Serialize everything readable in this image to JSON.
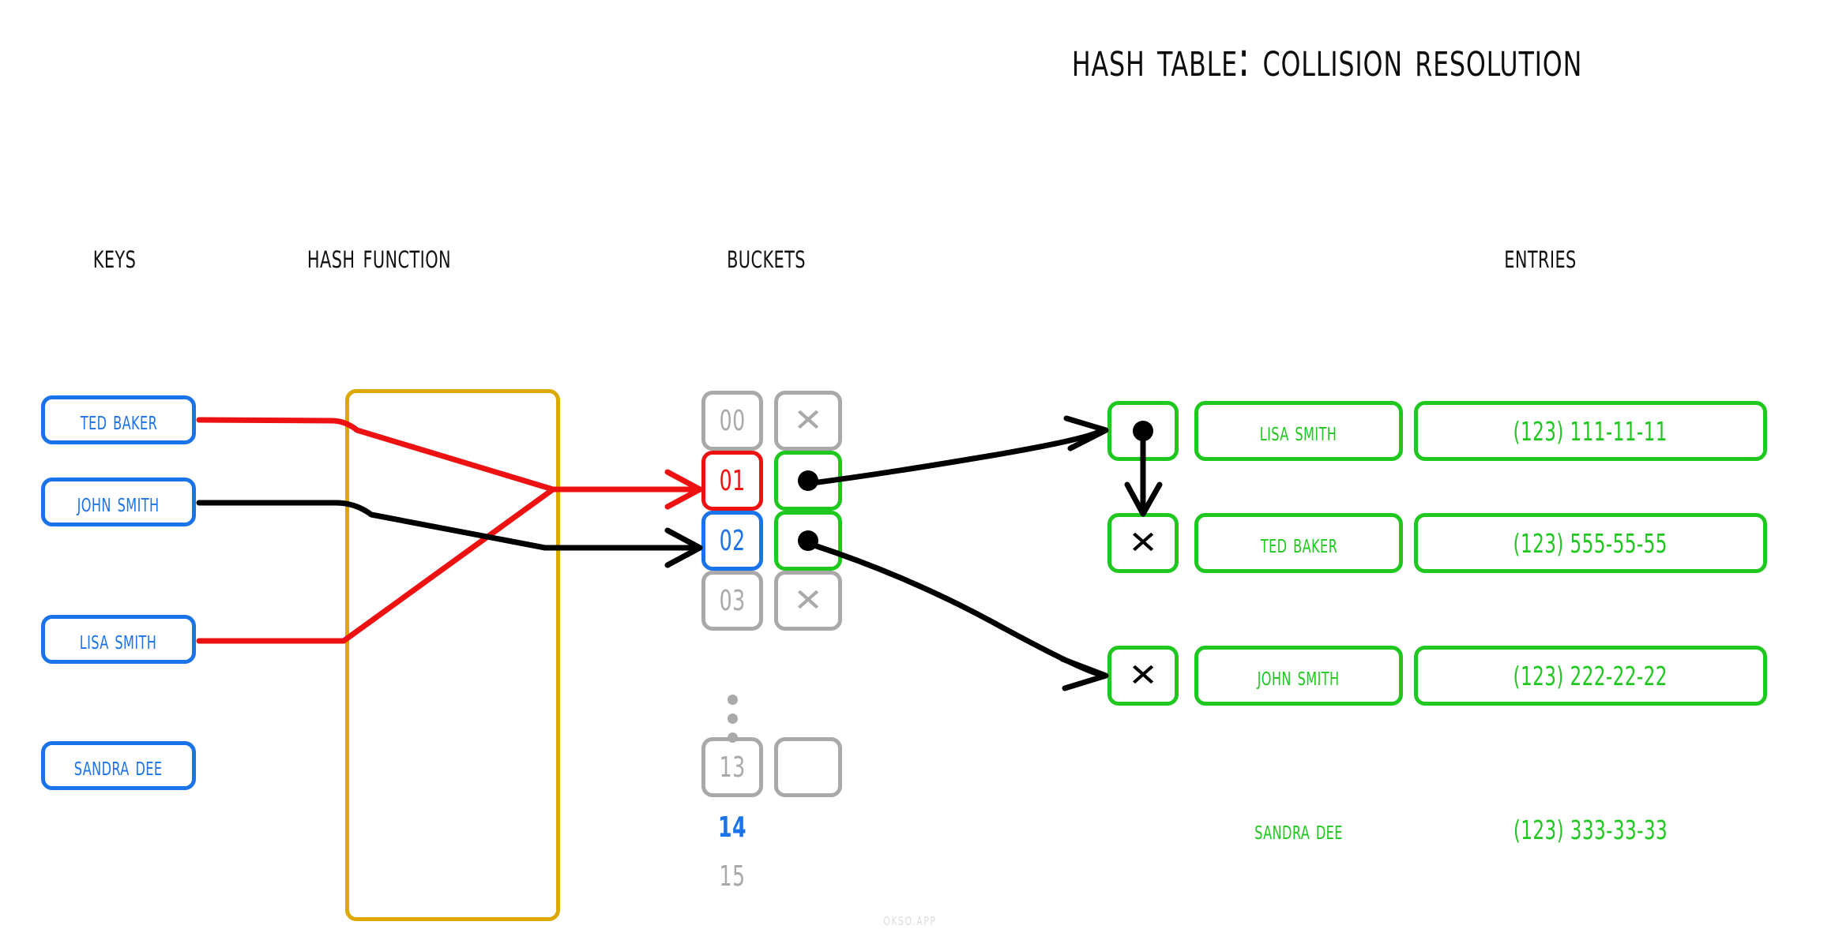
{
  "title": "Hash Table: Collision Resolution",
  "watermark": "OKSO.APP",
  "headers": {
    "keys": "Keys",
    "hash_function": "Hash Function",
    "buckets": "Buckets",
    "entries": "Entries"
  },
  "colors": {
    "key_blue": "#1a73e8",
    "entry_green": "#1ec81e",
    "bucket_gray": "#a9a9a9",
    "collision_red": "#ee1111",
    "hash_box_gold": "#dda800",
    "wire_black": "#000000"
  },
  "keys": [
    {
      "label": "Ted Baker",
      "wire_color": "#ee1111",
      "target_bucket": "01"
    },
    {
      "label": "John Smith",
      "wire_color": "#000000",
      "target_bucket": "02"
    },
    {
      "label": "Lisa Smith",
      "wire_color": "#ee1111",
      "target_bucket": "01"
    },
    {
      "label": "Sandra Dee",
      "wire_color": "none",
      "target_bucket": ""
    }
  ],
  "buckets": [
    {
      "index": "00",
      "state": "empty",
      "value_icon": "x-mark",
      "index_color": "#a9a9a9",
      "box_color": "#a9a9a9",
      "boxed": true
    },
    {
      "index": "01",
      "state": "filled",
      "value_icon": "dot",
      "index_color": "#ee1111",
      "box_color": "#1ec81e",
      "boxed": true
    },
    {
      "index": "02",
      "state": "filled",
      "value_icon": "dot",
      "index_color": "#1a73e8",
      "box_color": "#1ec81e",
      "boxed": true
    },
    {
      "index": "03",
      "state": "empty",
      "value_icon": "x-mark",
      "index_color": "#a9a9a9",
      "box_color": "#a9a9a9",
      "boxed": true
    },
    {
      "index": "13",
      "state": "blank",
      "value_icon": "none",
      "index_color": "#a9a9a9",
      "box_color": "#a9a9a9",
      "boxed": true
    },
    {
      "index": "14",
      "state": "label",
      "value_icon": "none",
      "index_color": "#1a73e8",
      "box_color": "none",
      "boxed": false
    },
    {
      "index": "15",
      "state": "label",
      "value_icon": "none",
      "index_color": "#a9a9a9",
      "box_color": "none",
      "boxed": false
    }
  ],
  "ellipsis": "vertical-dots",
  "entries": [
    {
      "pointer": "dot",
      "name": "Lisa Smith",
      "phone": "(123) 111-11-11",
      "boxed": true,
      "from_bucket": "01",
      "next": "Ted Baker"
    },
    {
      "pointer": "x-mark",
      "name": "Ted Baker",
      "phone": "(123) 555-55-55",
      "boxed": true,
      "from_bucket": "",
      "next": ""
    },
    {
      "pointer": "x-mark",
      "name": "John Smith",
      "phone": "(123) 222-22-22",
      "boxed": true,
      "from_bucket": "02",
      "next": ""
    },
    {
      "pointer": "none",
      "name": "Sandra Dee",
      "phone": "(123) 333-33-33",
      "boxed": false,
      "from_bucket": "",
      "next": ""
    }
  ]
}
